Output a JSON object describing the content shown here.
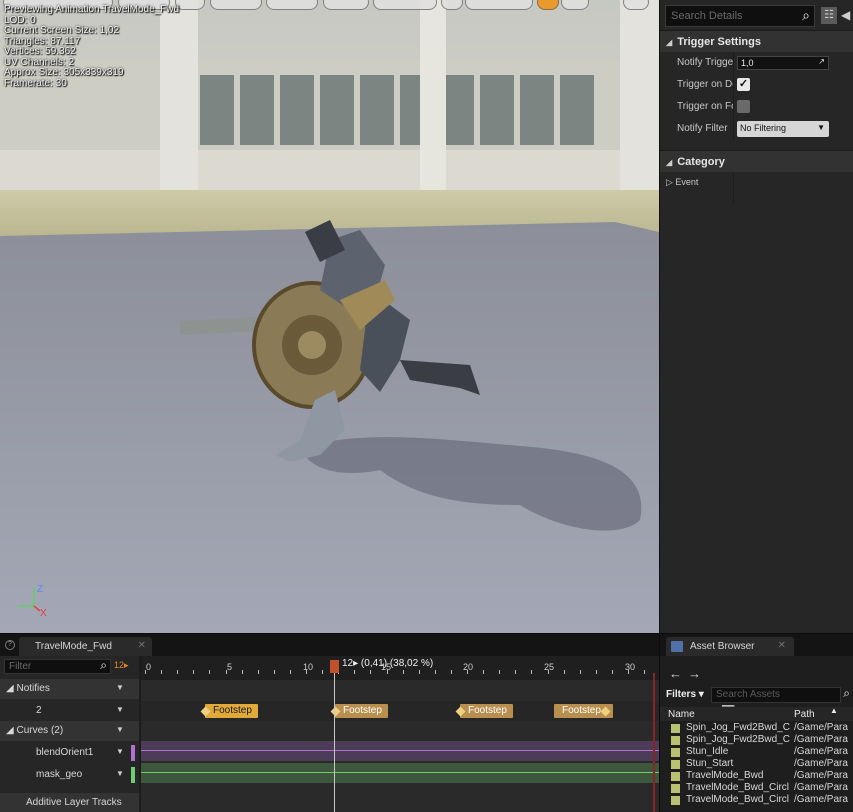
{
  "viewport": {
    "info_lines": [
      "Previewing Animation TravelMode_Fwd",
      "LOD: 0",
      "Current Screen Size: 1,02",
      "Triangles: 87.117",
      "Vertices: 59.362",
      "UV Channels: 2",
      "Approx Size: 305x339x319",
      "Framerate: 30"
    ],
    "axis_labels": {
      "z": "Z",
      "x": "X"
    }
  },
  "details": {
    "search_placeholder": "Search Details",
    "trigger_settings": {
      "header": "Trigger Settings",
      "rows": [
        {
          "label": "Notify Trigge",
          "value": "1,0"
        },
        {
          "label": "Trigger on De",
          "checked": true
        },
        {
          "label": "Trigger on Fc",
          "checked": false
        },
        {
          "label": "Notify Filter",
          "value": "No Filtering"
        }
      ]
    },
    "category": {
      "header": "Category",
      "rows": [
        {
          "label": "Event"
        }
      ]
    }
  },
  "timeline": {
    "tab_label": "TravelMode_Fwd",
    "filter_placeholder": "Filter",
    "current_frame_badge": "12▸",
    "scrub_label": "12▸ (0,41) (38,02 %)",
    "ruler_labels": [
      "0",
      "5",
      "10",
      "15",
      "20",
      "25",
      "30"
    ],
    "tracks": {
      "notifies": "Notifies",
      "notifies_count": "2",
      "curves": "Curves",
      "curves_count": "(2)",
      "curve_items": [
        "blendOrient1",
        "mask_geo"
      ],
      "additive": "Additive Layer Tracks"
    },
    "notifies": [
      {
        "label": "Footstep",
        "selected": true
      },
      {
        "label": "Footstep",
        "selected": false
      },
      {
        "label": "Footstep",
        "selected": false
      },
      {
        "label": "Footstep",
        "selected": false
      }
    ],
    "colors": {
      "curve1": "#b070d0",
      "curve2": "#72cc72",
      "scrub": "#c0502a"
    }
  },
  "asset_browser": {
    "tab_label": "Asset Browser",
    "filters_label": "Filters",
    "search_placeholder": "Search Assets",
    "columns": {
      "name": "Name",
      "path": "Path"
    },
    "items": [
      {
        "name": "Spin_Jog_Fwd2Bwd_C",
        "path": "/Game/Para"
      },
      {
        "name": "Spin_Jog_Fwd2Bwd_C",
        "path": "/Game/Para"
      },
      {
        "name": "Stun_Idle",
        "path": "/Game/Para"
      },
      {
        "name": "Stun_Start",
        "path": "/Game/Para"
      },
      {
        "name": "TravelMode_Bwd",
        "path": "/Game/Para"
      },
      {
        "name": "TravelMode_Bwd_Circl",
        "path": "/Game/Para"
      },
      {
        "name": "TravelMode_Bwd_Circl",
        "path": "/Game/Para"
      }
    ]
  }
}
